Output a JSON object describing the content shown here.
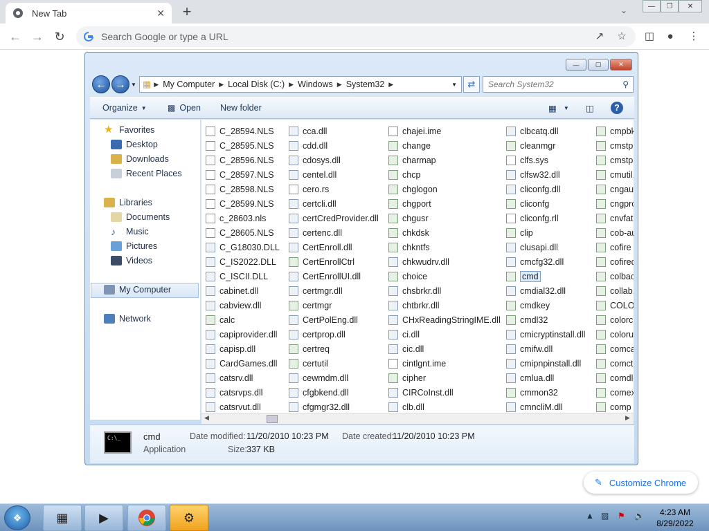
{
  "chrome": {
    "tab_title": "New Tab",
    "tab_close": "✕",
    "new_tab": "+",
    "omnibox_placeholder": "Search Google or type a URL",
    "customize_label": "Customize Chrome",
    "icons": [
      "back-arrow-icon",
      "forward-arrow-icon",
      "reload-icon",
      "share-icon",
      "star-icon",
      "side-panel-icon",
      "profile-icon",
      "menu-icon"
    ]
  },
  "explorer": {
    "breadcrumbs": [
      "My Computer",
      "Local Disk (C:)",
      "Windows",
      "System32"
    ],
    "search_placeholder": "Search System32",
    "commands": {
      "organize": "Organize",
      "open": "Open",
      "new_folder": "New folder"
    },
    "nav": {
      "favorites": "Favorites",
      "desktop": "Desktop",
      "downloads": "Downloads",
      "recent": "Recent Places",
      "libraries": "Libraries",
      "documents": "Documents",
      "music": "Music",
      "pictures": "Pictures",
      "videos": "Videos",
      "computer": "My Computer",
      "network": "Network"
    },
    "columns": [
      [
        "C_28594.NLS",
        "C_28595.NLS",
        "C_28596.NLS",
        "C_28597.NLS",
        "C_28598.NLS",
        "C_28599.NLS",
        "c_28603.nls",
        "C_28605.NLS",
        "C_G18030.DLL",
        "C_IS2022.DLL",
        "C_ISCII.DLL",
        "cabinet.dll",
        "cabview.dll",
        "calc",
        "capiprovider.dll",
        "capisp.dll",
        "CardGames.dll",
        "catsrv.dll",
        "catsrvps.dll",
        "catsrvut.dll"
      ],
      [
        "cca.dll",
        "cdd.dll",
        "cdosys.dll",
        "centel.dll",
        "cero.rs",
        "certcli.dll",
        "certCredProvider.dll",
        "certenc.dll",
        "CertEnroll.dll",
        "CertEnrollCtrl",
        "CertEnrollUI.dll",
        "certmgr.dll",
        "certmgr",
        "CertPolEng.dll",
        "certprop.dll",
        "certreq",
        "certutil",
        "cewmdm.dll",
        "cfgbkend.dll",
        "cfgmgr32.dll"
      ],
      [
        "chajei.ime",
        "change",
        "charmap",
        "chcp",
        "chglogon",
        "chgport",
        "chgusr",
        "chkdsk",
        "chkntfs",
        "chkwudrv.dll",
        "choice",
        "chsbrkr.dll",
        "chtbrkr.dll",
        "CHxReadingStringIME.dll",
        "ci.dll",
        "cic.dll",
        "cintlgnt.ime",
        "cipher",
        "CIRCoInst.dll",
        "clb.dll"
      ],
      [
        "clbcatq.dll",
        "cleanmgr",
        "clfs.sys",
        "clfsw32.dll",
        "cliconfg.dll",
        "cliconfg",
        "cliconfg.rll",
        "clip",
        "clusapi.dll",
        "cmcfg32.dll",
        "cmd",
        "cmdial32.dll",
        "cmdkey",
        "cmdl32",
        "cmicryptinstall.dll",
        "cmifw.dll",
        "cmipnpinstall.dll",
        "cmlua.dll",
        "cmmon32",
        "cmncliM.dll"
      ],
      [
        "cmpbk",
        "cmstp",
        "cmstpl",
        "cmutil.",
        "cngaud",
        "cngpro",
        "cnvfat.",
        "cob-au",
        "cofire",
        "cofired",
        "colbact",
        "collab.c",
        "COLOR",
        "colorcp",
        "colorui",
        "comcat",
        "comctl",
        "comdlg",
        "comexp",
        "comp"
      ]
    ],
    "selected_file": "cmd",
    "details": {
      "name": "cmd",
      "type": "Application",
      "modified_label": "Date modified:",
      "modified_value": "11/20/2010 10:23 PM",
      "created_label": "Date created:",
      "created_value": "11/20/2010 10:23 PM",
      "size_label": "Size:",
      "size_value": "337 KB"
    }
  },
  "taskbar": {
    "time": "4:23 AM",
    "date": "8/29/2022"
  }
}
